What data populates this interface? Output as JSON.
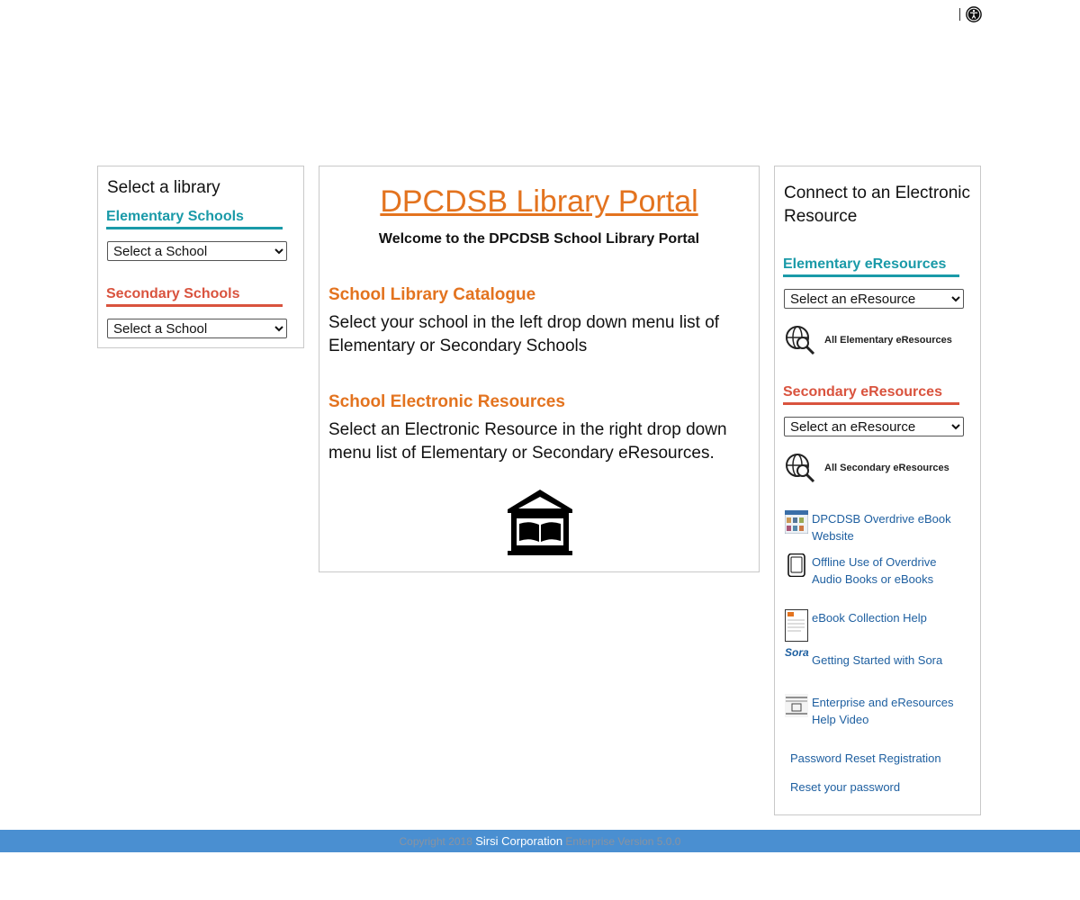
{
  "left_panel": {
    "title": "Select a library",
    "elementary_heading": "Elementary Schools",
    "elementary_select": "Select a School",
    "secondary_heading": "Secondary Schools",
    "secondary_select": "Select a School"
  },
  "center_panel": {
    "title": "DPCDSB Library Portal",
    "welcome": "Welcome to the DPCDSB School Library Portal",
    "catalogue_heading": "School Library Catalogue",
    "catalogue_text": "Select your school in the left drop down menu list of Elementary or Secondary Schools",
    "eresources_heading": "School Electronic Resources",
    "eresources_text": "Select an Electronic Resource in the right drop down menu list of Elementary or Secondary eResources.",
    "icon": "library-building-icon"
  },
  "right_panel": {
    "title": "Connect to an Electronic Resource",
    "elementary_heading": "Elementary eResources",
    "elementary_select": "Select an eResource",
    "all_elementary": "All Elementary eResources",
    "secondary_heading": "Secondary eResources",
    "secondary_select": "Select an eResource",
    "all_secondary": "All Secondary eResources",
    "links": [
      {
        "label": "DPCDSB Overdrive eBook Website",
        "icon": "overdrive-thumbnail-icon"
      },
      {
        "label": "Offline Use of Overdrive Audio Books or eBooks",
        "icon": "tablet-icon"
      },
      {
        "label": "eBook Collection Help",
        "icon": "document-thumbnail-icon"
      },
      {
        "label": "Getting Started with Sora",
        "icon": "sora-logo-icon",
        "logo_text": "Sora"
      },
      {
        "label": "Enterprise and eResources Help Video",
        "icon": "video-thumbnail-icon"
      }
    ],
    "password_reset_registration": "Password Reset Registration",
    "reset_password": "Reset your password"
  },
  "footer": {
    "copyright": "Copyright 2018",
    "company": "Sirsi Corporation",
    "version": "Enterprise Version 5.0.0"
  },
  "colors": {
    "orange": "#e3731f",
    "teal": "#1a9aa8",
    "red": "#d9533e",
    "link": "#1e5fa0",
    "footer": "#4a8fd1"
  },
  "top_icon": "accessibility-icon"
}
